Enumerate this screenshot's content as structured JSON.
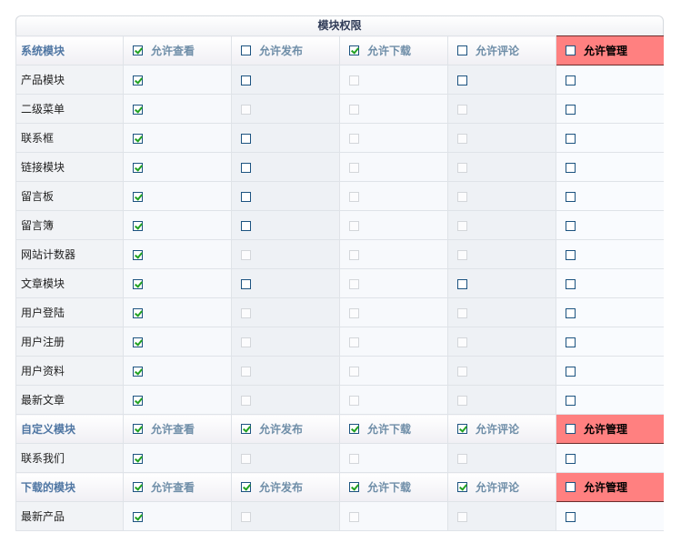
{
  "title": "模块权限",
  "perm_labels": [
    "允许查看",
    "允许发布",
    "允许下载",
    "允许评论",
    "允许管理"
  ],
  "groups": [
    {
      "name": "系统模块",
      "header_checks": [
        true,
        false,
        true,
        false,
        false
      ],
      "rows": [
        {
          "name": "产品模块",
          "checks": [
            [
              "on",
              true
            ],
            [
              "on",
              false
            ],
            [
              "dis",
              false
            ],
            [
              "on",
              false
            ],
            [
              "on",
              false
            ]
          ]
        },
        {
          "name": "二级菜单",
          "checks": [
            [
              "on",
              true
            ],
            [
              "dis",
              false
            ],
            [
              "dis",
              false
            ],
            [
              "dis",
              false
            ],
            [
              "on",
              false
            ]
          ]
        },
        {
          "name": "联系框",
          "checks": [
            [
              "on",
              true
            ],
            [
              "on",
              false
            ],
            [
              "dis",
              false
            ],
            [
              "dis",
              false
            ],
            [
              "on",
              false
            ]
          ]
        },
        {
          "name": "链接模块",
          "checks": [
            [
              "on",
              true
            ],
            [
              "on",
              false
            ],
            [
              "dis",
              false
            ],
            [
              "dis",
              false
            ],
            [
              "on",
              false
            ]
          ]
        },
        {
          "name": "留言板",
          "checks": [
            [
              "on",
              true
            ],
            [
              "on",
              false
            ],
            [
              "dis",
              false
            ],
            [
              "dis",
              false
            ],
            [
              "on",
              false
            ]
          ]
        },
        {
          "name": "留言簿",
          "checks": [
            [
              "on",
              true
            ],
            [
              "on",
              false
            ],
            [
              "dis",
              false
            ],
            [
              "dis",
              false
            ],
            [
              "on",
              false
            ]
          ]
        },
        {
          "name": "网站计数器",
          "checks": [
            [
              "on",
              true
            ],
            [
              "dis",
              false
            ],
            [
              "dis",
              false
            ],
            [
              "dis",
              false
            ],
            [
              "on",
              false
            ]
          ]
        },
        {
          "name": "文章模块",
          "checks": [
            [
              "on",
              true
            ],
            [
              "on",
              false
            ],
            [
              "dis",
              false
            ],
            [
              "on",
              false
            ],
            [
              "on",
              false
            ]
          ]
        },
        {
          "name": "用户登陆",
          "checks": [
            [
              "on",
              true
            ],
            [
              "dis",
              false
            ],
            [
              "dis",
              false
            ],
            [
              "dis",
              false
            ],
            [
              "on",
              false
            ]
          ]
        },
        {
          "name": "用户注册",
          "checks": [
            [
              "on",
              true
            ],
            [
              "dis",
              false
            ],
            [
              "dis",
              false
            ],
            [
              "dis",
              false
            ],
            [
              "on",
              false
            ]
          ]
        },
        {
          "name": "用户资料",
          "checks": [
            [
              "on",
              true
            ],
            [
              "dis",
              false
            ],
            [
              "dis",
              false
            ],
            [
              "dis",
              false
            ],
            [
              "on",
              false
            ]
          ]
        },
        {
          "name": "最新文章",
          "checks": [
            [
              "on",
              true
            ],
            [
              "dis",
              false
            ],
            [
              "dis",
              false
            ],
            [
              "dis",
              false
            ],
            [
              "on",
              false
            ]
          ]
        }
      ]
    },
    {
      "name": "自定义模块",
      "header_checks": [
        true,
        true,
        true,
        true,
        false
      ],
      "rows": [
        {
          "name": "联系我们",
          "checks": [
            [
              "on",
              true
            ],
            [
              "dis",
              false
            ],
            [
              "dis",
              false
            ],
            [
              "dis",
              false
            ],
            [
              "on",
              false
            ]
          ]
        }
      ]
    },
    {
      "name": "下载的模块",
      "header_checks": [
        true,
        true,
        true,
        true,
        false
      ],
      "rows": [
        {
          "name": "最新产品",
          "checks": [
            [
              "on",
              true
            ],
            [
              "dis",
              false
            ],
            [
              "dis",
              false
            ],
            [
              "dis",
              false
            ],
            [
              "on",
              false
            ]
          ]
        }
      ]
    }
  ]
}
